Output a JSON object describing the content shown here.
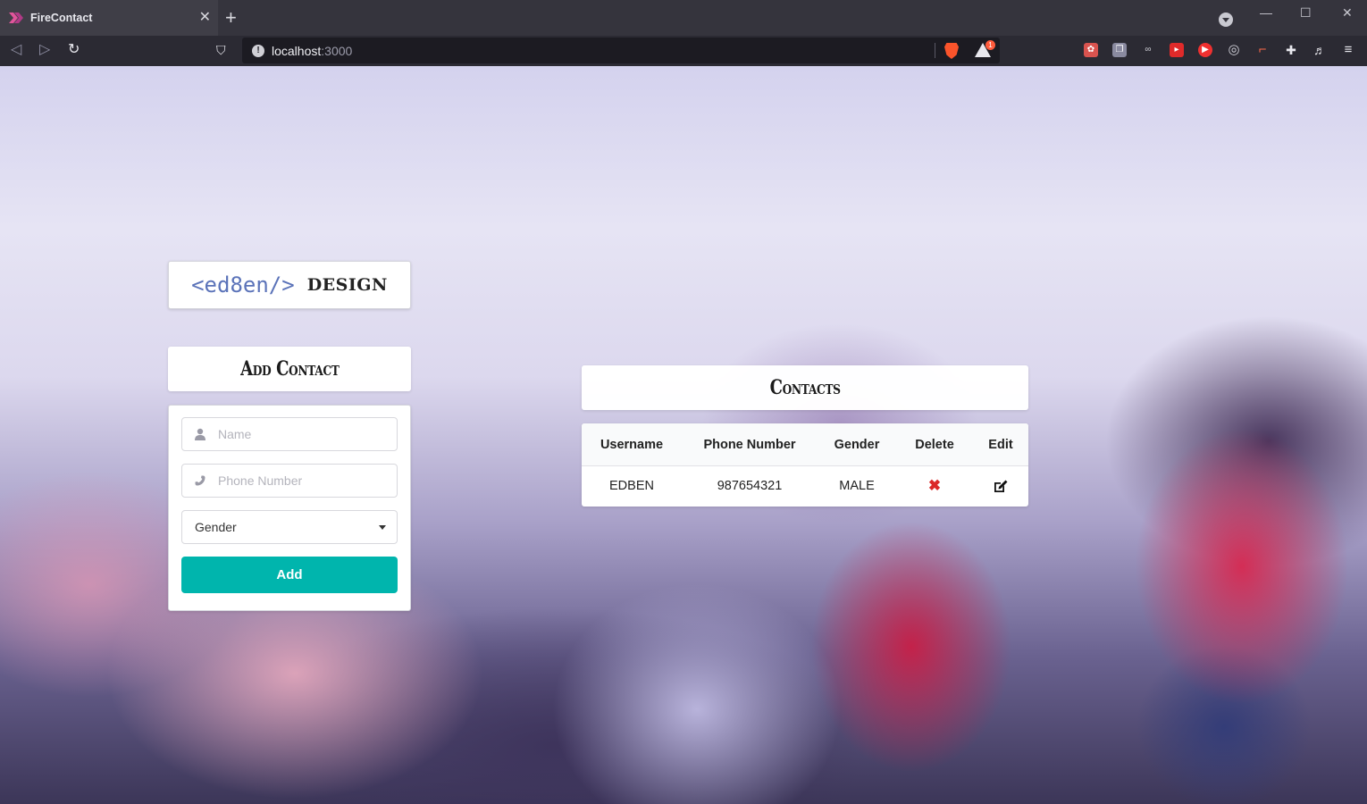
{
  "browser": {
    "tab_title": "FireContact",
    "tab_close": "✕",
    "new_tab": "+",
    "url_host": "localhost",
    "url_port": ":3000",
    "rewards_badge": "1",
    "minimize": "—",
    "maximize": "☐",
    "close": "✕"
  },
  "logo": {
    "code_text": "<ed8en/>",
    "design_text": "DESIGN"
  },
  "add_contact": {
    "title": "Add Contact",
    "name_placeholder": "Name",
    "phone_placeholder": "Phone Number",
    "gender_select": "Gender",
    "add_label": "Add"
  },
  "contacts": {
    "title": "Contacts",
    "columns": [
      "Username",
      "Phone Number",
      "Gender",
      "Delete",
      "Edit"
    ],
    "rows": [
      {
        "username": "EDBEN",
        "phone": "987654321",
        "gender": "MALE"
      }
    ],
    "delete_glyph": "✖"
  },
  "colors": {
    "accent": "#00b5ad",
    "delete": "#db2828",
    "logo_code": "#5b73b9"
  }
}
